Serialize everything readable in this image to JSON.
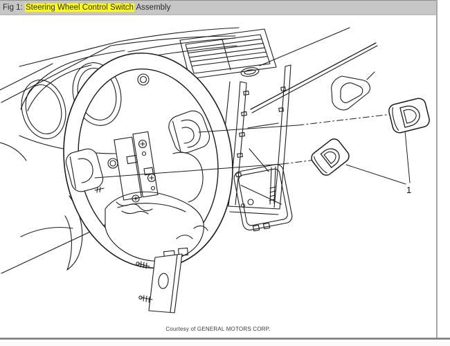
{
  "titlebar": {
    "prefix": "Fig 1: ",
    "highlighted": "Steering Wheel Control Switch",
    "suffix": " Assembly"
  },
  "diagram": {
    "callout_label": "1"
  },
  "footer": {
    "credit": "Courtesy of GENERAL MOTORS CORP."
  },
  "colors": {
    "titlebar_bg": "#c6c6c6",
    "highlight": "#ffff00",
    "line": "#1c1c1c",
    "canvas": "#ffffff",
    "frame_border": "#a8a8a8",
    "bottom_border": "#6e6e6e"
  }
}
